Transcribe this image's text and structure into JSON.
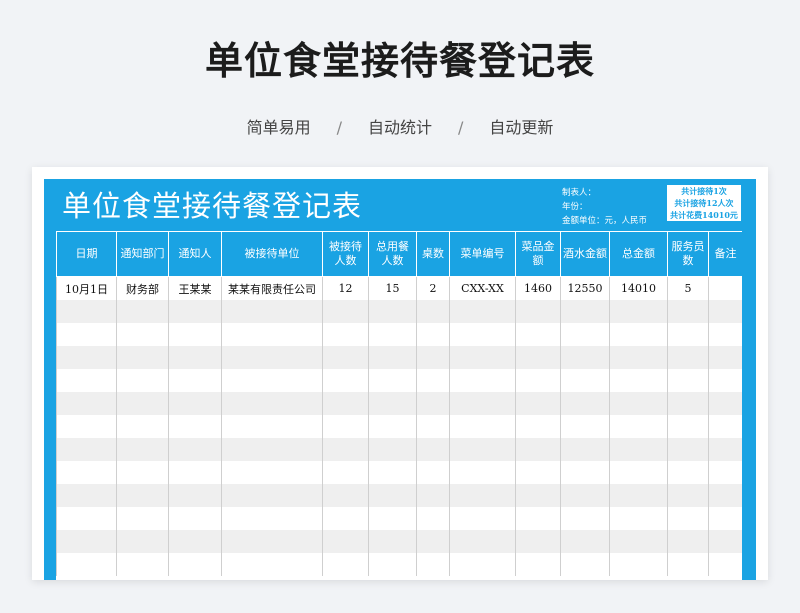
{
  "page": {
    "title": "单位食堂接待餐登记表",
    "subtitle_items": [
      "简单易用",
      "自动统计",
      "自动更新"
    ],
    "separator": "/"
  },
  "sheet": {
    "title": "单位食堂接待餐登记表",
    "meta": {
      "maker": "制表人：",
      "year": "年份：",
      "unit": "金额单位：元，人民币"
    },
    "summary": {
      "line1": "共计接待1次",
      "line2": "共计接待12人次",
      "line3": "共计花费14010元"
    },
    "columns": [
      {
        "label": "日期"
      },
      {
        "label": "通知部门"
      },
      {
        "label": "通知人"
      },
      {
        "label": "被接待单位"
      },
      {
        "label": "被接待人数"
      },
      {
        "label": "总用餐人数"
      },
      {
        "label": "桌数"
      },
      {
        "label": "菜单编号"
      },
      {
        "label": "菜品金额"
      },
      {
        "label": "酒水金额"
      },
      {
        "label": "总金额"
      },
      {
        "label": "服务员数"
      },
      {
        "label": "备注"
      }
    ],
    "rows": [
      [
        "10月1日",
        "财务部",
        "王某某",
        "某某有限责任公司",
        "12",
        "15",
        "2",
        "CXX-XX",
        "1460",
        "12550",
        "14010",
        "5",
        ""
      ]
    ],
    "empty_rows": 12
  },
  "colors": {
    "accent": "#1aa3e3",
    "alt_row": "#efefef",
    "page_bg": "#f1f3f6"
  }
}
